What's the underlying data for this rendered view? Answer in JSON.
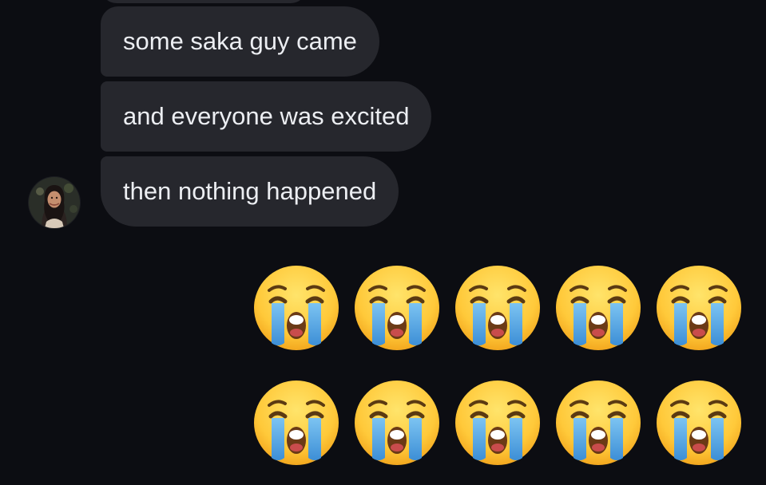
{
  "conversation": {
    "messages": [
      {
        "sender": "other",
        "text": "some saka guy came"
      },
      {
        "sender": "other",
        "text": "and everyone was excited"
      },
      {
        "sender": "other",
        "text": "then nothing happened"
      }
    ],
    "reply": {
      "sender": "self",
      "emoji_rows": [
        [
          "loudly-crying-face",
          "loudly-crying-face",
          "loudly-crying-face",
          "loudly-crying-face",
          "loudly-crying-face"
        ],
        [
          "loudly-crying-face",
          "loudly-crying-face",
          "loudly-crying-face",
          "loudly-crying-face",
          "loudly-crying-face"
        ]
      ]
    }
  },
  "colors": {
    "background": "#0c0d12",
    "bubble": "#26272d",
    "bubble_text": "#eceef2"
  }
}
